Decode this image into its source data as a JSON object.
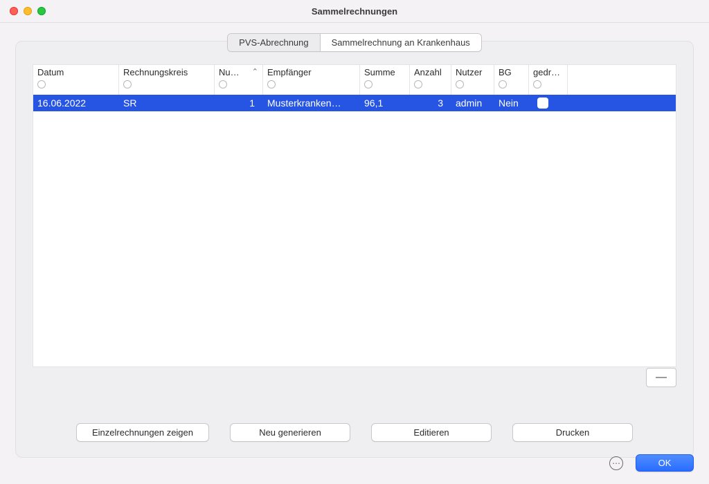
{
  "window_title": "Sammelrechnungen",
  "tabs": {
    "pvs": "PVS-Abrechnung",
    "sammel": "Sammelrechnung an Krankenhaus"
  },
  "columns": {
    "datum": "Datum",
    "rechnungskreis": "Rechnungskreis",
    "nummer": "Nu…",
    "empfaenger": "Empfänger",
    "summe": "Summe",
    "anzahl": "Anzahl",
    "nutzer": "Nutzer",
    "bg": "BG",
    "gedruckt": "gedruckt"
  },
  "rows": [
    {
      "datum": "16.06.2022",
      "rechnungskreis": "SR",
      "nummer": "1",
      "empfaenger": "Musterkranken…",
      "summe": "96,1",
      "anzahl": "3",
      "nutzer": "admin",
      "bg": "Nein",
      "gedruckt": false
    }
  ],
  "buttons": {
    "einzel": "Einzelrechnungen zeigen",
    "neu": "Neu generieren",
    "edit": "Editieren",
    "drucken": "Drucken",
    "remove": "—"
  },
  "footer": {
    "help": "⋯",
    "ok": "OK"
  }
}
